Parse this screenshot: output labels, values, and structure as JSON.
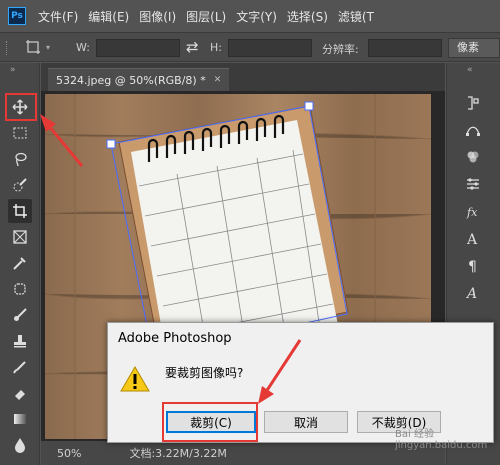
{
  "menu": {
    "logo": "Ps",
    "items": [
      "文件(F)",
      "编辑(E)",
      "图像(I)",
      "图层(L)",
      "文字(Y)",
      "选择(S)",
      "滤镜(T"
    ]
  },
  "options": {
    "w_label": "W:",
    "h_label": "H:",
    "resolution_label": "分辨率:",
    "unit_value": "像素",
    "swap_icon": "⇄"
  },
  "document": {
    "tab_label": "5324.jpeg @ 50%(RGB/8) *",
    "tab_close": "✕"
  },
  "status": {
    "zoom": "50%",
    "doc_info": "文档:3.22M/3.22M"
  },
  "dialog": {
    "title": "Adobe Photoshop",
    "message": "要裁剪图像吗?",
    "crop_button": "裁剪(C)",
    "cancel_button": "取消",
    "no_crop_button": "不裁剪(D)"
  },
  "watermark": "Bai 经验 jingyan.baidu.com",
  "colors": {
    "annotation_red": "#e53935",
    "accent_blue": "#31a8ff"
  },
  "icons": {
    "warning": "warning-icon",
    "move": "move-tool-icon"
  }
}
